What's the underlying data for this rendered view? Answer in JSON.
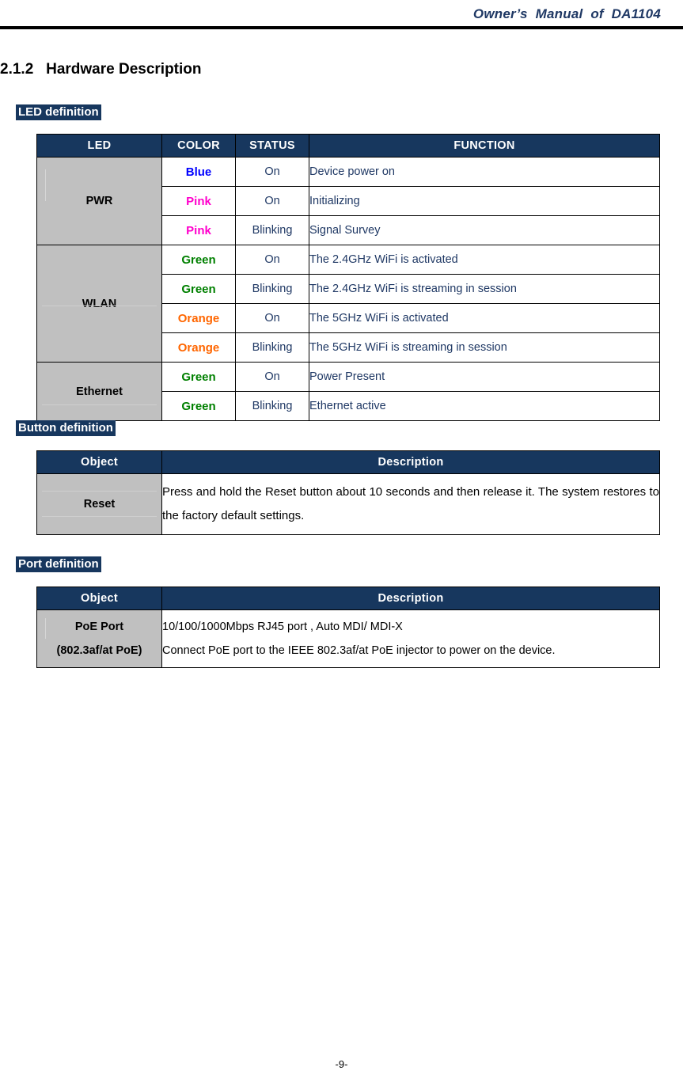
{
  "header": {
    "title": "Owner’s Manual of DA1104"
  },
  "heading": {
    "number": "2.1.2",
    "text": "Hardware Description",
    "full": "2.1.2   Hardware Description"
  },
  "labels": {
    "led": "LED definition",
    "button": "Button definition",
    "port": "Port definition"
  },
  "colors": {
    "header_navy": "#17375E",
    "body_navy": "#1F3864",
    "cell_gray": "#C0C0C0",
    "blue": "#0000FF",
    "pink": "#FF00CC",
    "green": "#008000",
    "orange": "#FF6600"
  },
  "led_table": {
    "columns": [
      "LED",
      "COLOR",
      "STATUS",
      "FUNCTION"
    ],
    "groups": [
      {
        "name": "PWR",
        "rows": [
          {
            "color": "Blue",
            "color_key": "blue",
            "status": "On",
            "function": "Device power on"
          },
          {
            "color": "Pink",
            "color_key": "pink",
            "status": "On",
            "function": "Initializing"
          },
          {
            "color": "Pink",
            "color_key": "pink",
            "status": "Blinking",
            "function": "Signal Survey"
          }
        ]
      },
      {
        "name": "WLAN",
        "rows": [
          {
            "color": "Green",
            "color_key": "green",
            "status": "On",
            "function": "The 2.4GHz WiFi is activated"
          },
          {
            "color": "Green",
            "color_key": "green",
            "status": "Blinking",
            "function": "The 2.4GHz WiFi is streaming in session"
          },
          {
            "color": "Orange",
            "color_key": "orange",
            "status": "On",
            "function": "The 5GHz WiFi is activated"
          },
          {
            "color": "Orange",
            "color_key": "orange",
            "status": "Blinking",
            "function": "The 5GHz WiFi is streaming in session"
          }
        ]
      },
      {
        "name": "Ethernet",
        "rows": [
          {
            "color": "Green",
            "color_key": "green",
            "status": "On",
            "function": "Power Present"
          },
          {
            "color": "Green",
            "color_key": "green",
            "status": "Blinking",
            "function": "Ethernet active"
          }
        ]
      }
    ]
  },
  "button_table": {
    "columns": [
      "Object",
      "Description"
    ],
    "rows": [
      {
        "object": "Reset",
        "description": "Press and hold the Reset button about 10 seconds and then release it. The system restores to the factory default settings."
      }
    ]
  },
  "port_table": {
    "columns": [
      "Object",
      "Description"
    ],
    "rows": [
      {
        "object_line1": "PoE Port",
        "object_line2": "(802.3af/at PoE)",
        "description_line1": "10/100/1000Mbps RJ45 port , Auto MDI/ MDI-X",
        "description_line2": "Connect PoE port to the IEEE 802.3af/at PoE injector to power on the device."
      }
    ]
  },
  "footer": {
    "page_number": "-9-"
  }
}
